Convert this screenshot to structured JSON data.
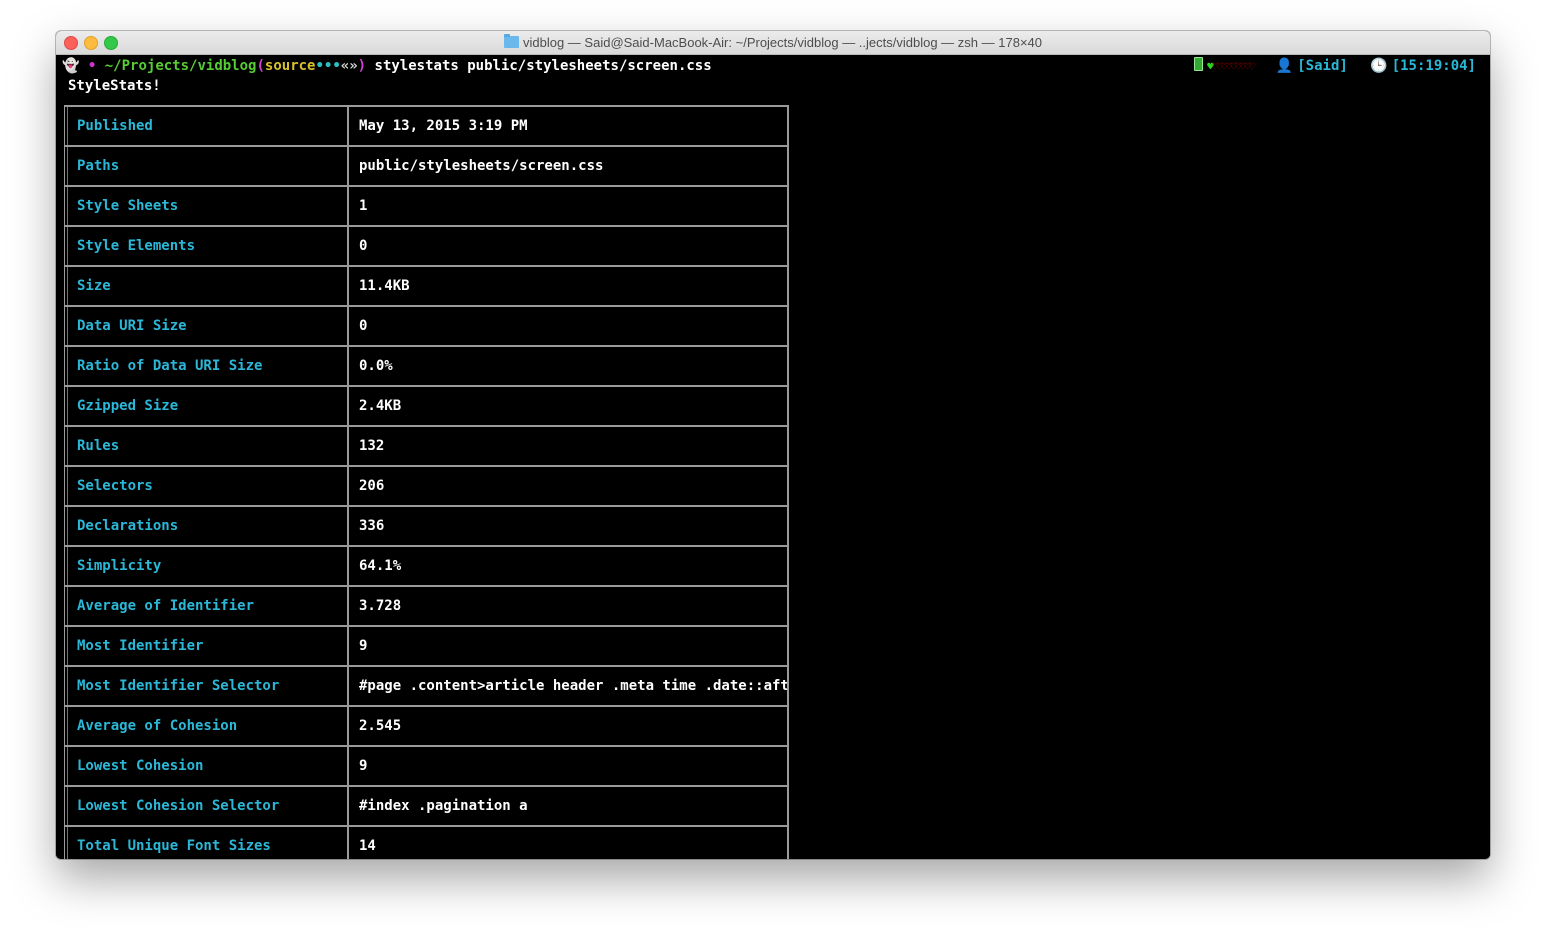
{
  "window": {
    "title": "vidblog — Said@Said-MacBook-Air: ~/Projects/vidblog — ..jects/vidblog — zsh — 178×40"
  },
  "prompt": {
    "ghost": "👻",
    "bullet": "•",
    "path": "~/Projects/vidblog",
    "branch_open": "(",
    "branch": "source",
    "dirty_dots": "•••",
    "arrows": "«»",
    "branch_close": ")",
    "apple": "",
    "command": "stylestats public/stylesheets/screen.css"
  },
  "rprompt": {
    "hearts_full": "♥",
    "hearts_empty": "♡♡♡♡♡♡♡♡♡",
    "user_icon": "👤",
    "user": "[Said]",
    "clock_icon": "🕒",
    "time": "[15:19:04]"
  },
  "output": {
    "banner": "StyleStats!",
    "rows": [
      {
        "key": "Published",
        "value": "May 13, 2015 3:19 PM"
      },
      {
        "key": "Paths",
        "value": "public/stylesheets/screen.css"
      },
      {
        "key": "Style Sheets",
        "value": "1"
      },
      {
        "key": "Style Elements",
        "value": "0"
      },
      {
        "key": "Size",
        "value": "11.4KB"
      },
      {
        "key": "Data URI Size",
        "value": "0"
      },
      {
        "key": "Ratio of Data URI Size",
        "value": "0.0%"
      },
      {
        "key": "Gzipped Size",
        "value": "2.4KB"
      },
      {
        "key": "Rules",
        "value": "132"
      },
      {
        "key": "Selectors",
        "value": "206"
      },
      {
        "key": "Declarations",
        "value": "336"
      },
      {
        "key": "Simplicity",
        "value": "64.1%"
      },
      {
        "key": "Average of Identifier",
        "value": "3.728"
      },
      {
        "key": "Most Identifier",
        "value": "9"
      },
      {
        "key": "Most Identifier Selector",
        "value": "#page .content>article header .meta time .date::after"
      },
      {
        "key": "Average of Cohesion",
        "value": "2.545"
      },
      {
        "key": "Lowest Cohesion",
        "value": "9"
      },
      {
        "key": "Lowest Cohesion Selector",
        "value": "#index .pagination a"
      },
      {
        "key": "Total Unique Font Sizes",
        "value": "14"
      }
    ]
  },
  "colors": {
    "key_text": "#2bb8d8",
    "path_green": "#55cc33",
    "branch_yellow": "#d8c22b",
    "background": "#000000"
  }
}
